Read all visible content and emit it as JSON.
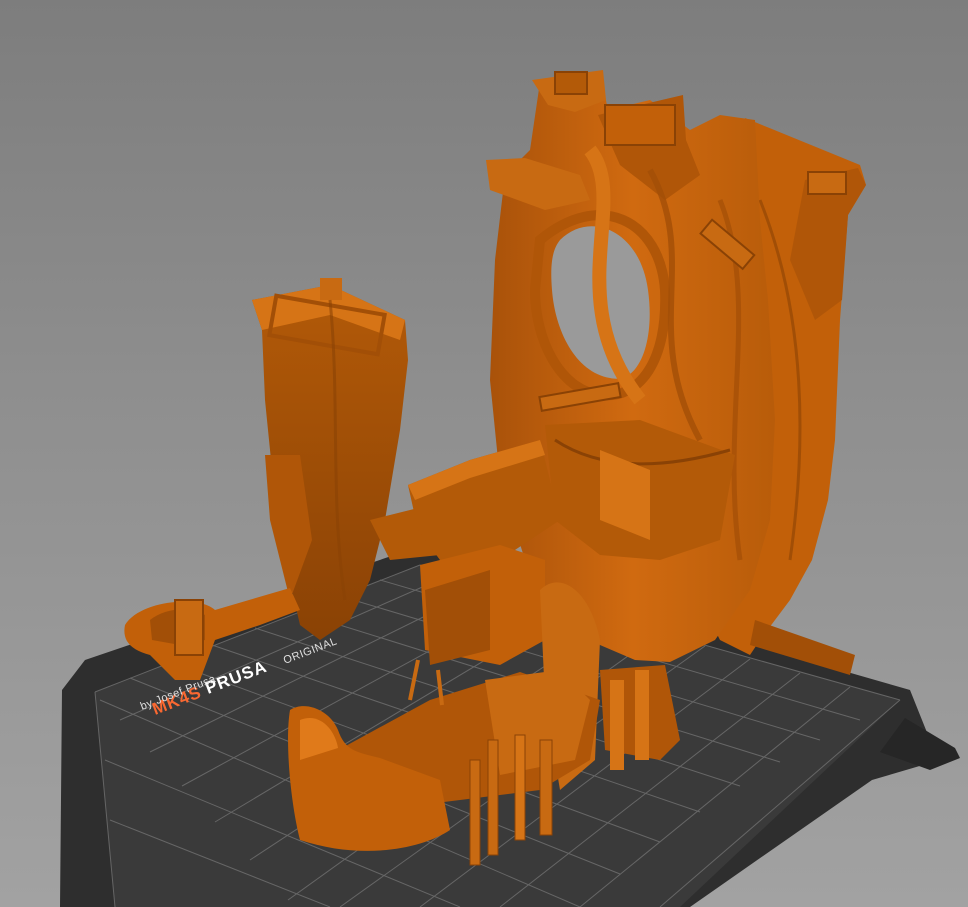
{
  "viewport": {
    "background_top": "#7d7d7d",
    "background_bottom": "#a2a2a2"
  },
  "print_bed": {
    "brand_prefix": "ORIGINAL",
    "brand_name": "PRUSA",
    "model_name": "MK4S",
    "byline": "by Josef Prusa",
    "sheet_color": "#333333",
    "grid_color": "#6e6e6e",
    "accent_color": "#fa6831"
  },
  "model": {
    "color": "#c8650a",
    "shadow_color": "#8a4205",
    "highlight_color": "#e07a1a",
    "parts": [
      "left-tower-part",
      "center-main-body-part",
      "right-fin-part",
      "front-base-part",
      "left-foot-part"
    ]
  }
}
